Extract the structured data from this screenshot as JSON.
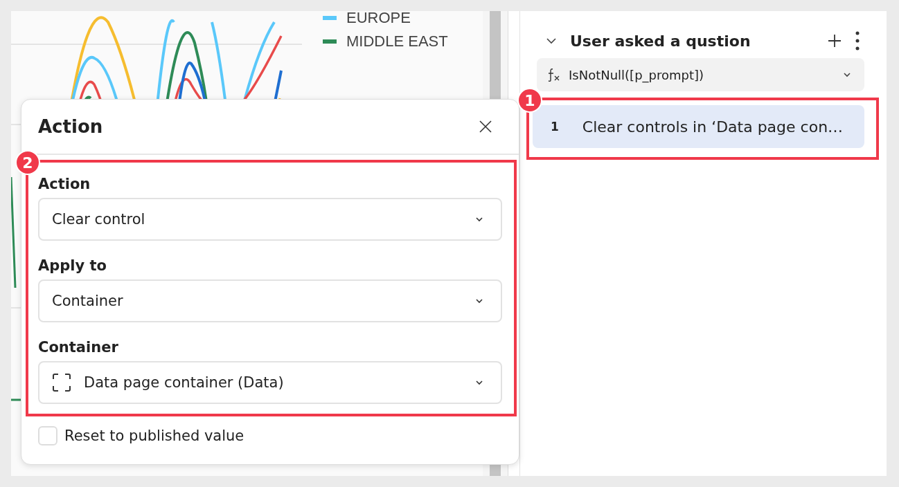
{
  "chart": {
    "legend": [
      {
        "label": "EUROPE",
        "color": "#5ac8fa"
      },
      {
        "label": "MIDDLE EAST",
        "color": "#2e8b57"
      }
    ]
  },
  "action_dialog": {
    "title": "Action",
    "fields": [
      {
        "label": "Action",
        "value": "Clear control",
        "kind": "select"
      },
      {
        "label": "Apply to",
        "value": "Container",
        "kind": "select"
      },
      {
        "label": "Container",
        "value": "Data page container (Data)",
        "kind": "container-select"
      }
    ],
    "reset_checkbox": {
      "label": "Reset to published value",
      "checked": false
    }
  },
  "sequence_panel": {
    "title": "User asked a qustion",
    "expanded": true,
    "condition": "IsNotNull([p_prompt])",
    "actions": [
      {
        "number": "1",
        "text": "Clear controls in ‘Data page con…",
        "selected": true
      }
    ]
  },
  "callouts": [
    {
      "number": "1"
    },
    {
      "number": "2"
    }
  ]
}
